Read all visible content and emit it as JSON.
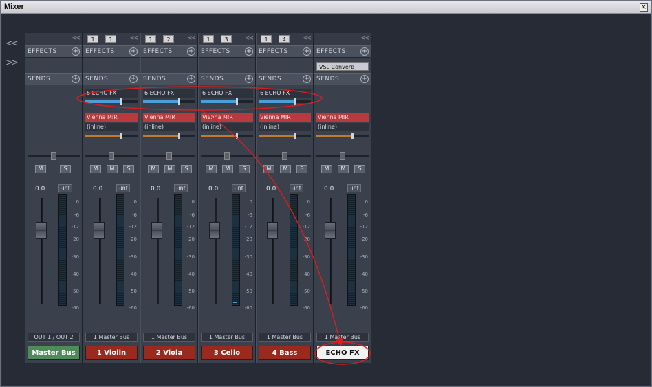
{
  "window": {
    "title": "Mixer",
    "close_label": "×"
  },
  "nav": {
    "left_icon": "<<",
    "right_icon": ">>"
  },
  "labels": {
    "effects": "EFFECTS",
    "sends": "SENDS",
    "plus": "+",
    "collapse": "<<",
    "mute": "M",
    "solo": "S"
  },
  "channels": [
    {
      "io": [],
      "effects_slot": "",
      "send_name": "",
      "send_level": 0,
      "insert_name": "",
      "insert_sub": "",
      "insert_level": 0,
      "pan": 0.5,
      "volume": "0.0",
      "peak": "-inf",
      "output": "OUT 1 / OUT 2",
      "name": "Master Bus",
      "color": "#4f8a5a",
      "plate_text_color": "#ffffff",
      "meter_peak": false
    },
    {
      "io": [
        "1",
        "1"
      ],
      "effects_slot": "",
      "send_name": "6 ECHO FX",
      "send_level": 0.68,
      "insert_name": "Vienna MIR",
      "insert_sub": "(inline)",
      "insert_level": 0.68,
      "pan": 0.5,
      "volume": "0.0",
      "peak": "-inf",
      "output": "1 Master Bus",
      "name": "1 Violin",
      "color": "#9a2a1e",
      "plate_text_color": "#ffffff",
      "meter_peak": false
    },
    {
      "io": [
        "1",
        "2"
      ],
      "effects_slot": "",
      "send_name": "6 ECHO FX",
      "send_level": 0.68,
      "insert_name": "Vienna MIR",
      "insert_sub": "(inline)",
      "insert_level": 0.68,
      "pan": 0.5,
      "volume": "0.0",
      "peak": "-inf",
      "output": "1 Master Bus",
      "name": "2 Viola",
      "color": "#9a2a1e",
      "plate_text_color": "#ffffff",
      "meter_peak": false
    },
    {
      "io": [
        "1",
        "3"
      ],
      "effects_slot": "",
      "send_name": "6 ECHO FX",
      "send_level": 0.68,
      "insert_name": "Vienna MIR",
      "insert_sub": "(inline)",
      "insert_level": 0.68,
      "pan": 0.5,
      "volume": "0.0",
      "peak": "-inf",
      "output": "1 Master Bus",
      "name": "3 Cello",
      "color": "#9a2a1e",
      "plate_text_color": "#ffffff",
      "meter_peak": true
    },
    {
      "io": [
        "1",
        "4"
      ],
      "effects_slot": "",
      "send_name": "6 ECHO FX",
      "send_level": 0.68,
      "insert_name": "Vienna MIR",
      "insert_sub": "(inline)",
      "insert_level": 0.68,
      "pan": 0.5,
      "volume": "0.0",
      "peak": "-inf",
      "output": "1 Master Bus",
      "name": "4 Bass",
      "color": "#9a2a1e",
      "plate_text_color": "#ffffff",
      "meter_peak": false
    },
    {
      "io": [],
      "effects_slot": "VSL Converb",
      "send_name": "",
      "send_level": 0,
      "insert_name": "Vienna MIR",
      "insert_sub": "(inline)",
      "insert_level": 0.68,
      "pan": 0.5,
      "volume": "0.0",
      "peak": "-inf",
      "output": "1 Master Bus",
      "name": "ECHO FX",
      "color": "#f2f2f2",
      "plate_text_color": "#111111",
      "meter_peak": false
    }
  ],
  "scale_marks": [
    "0",
    "-6",
    "-12",
    "-20",
    "-30",
    "-40",
    "-50",
    "-60"
  ],
  "annotation_color": "#d81e1e"
}
